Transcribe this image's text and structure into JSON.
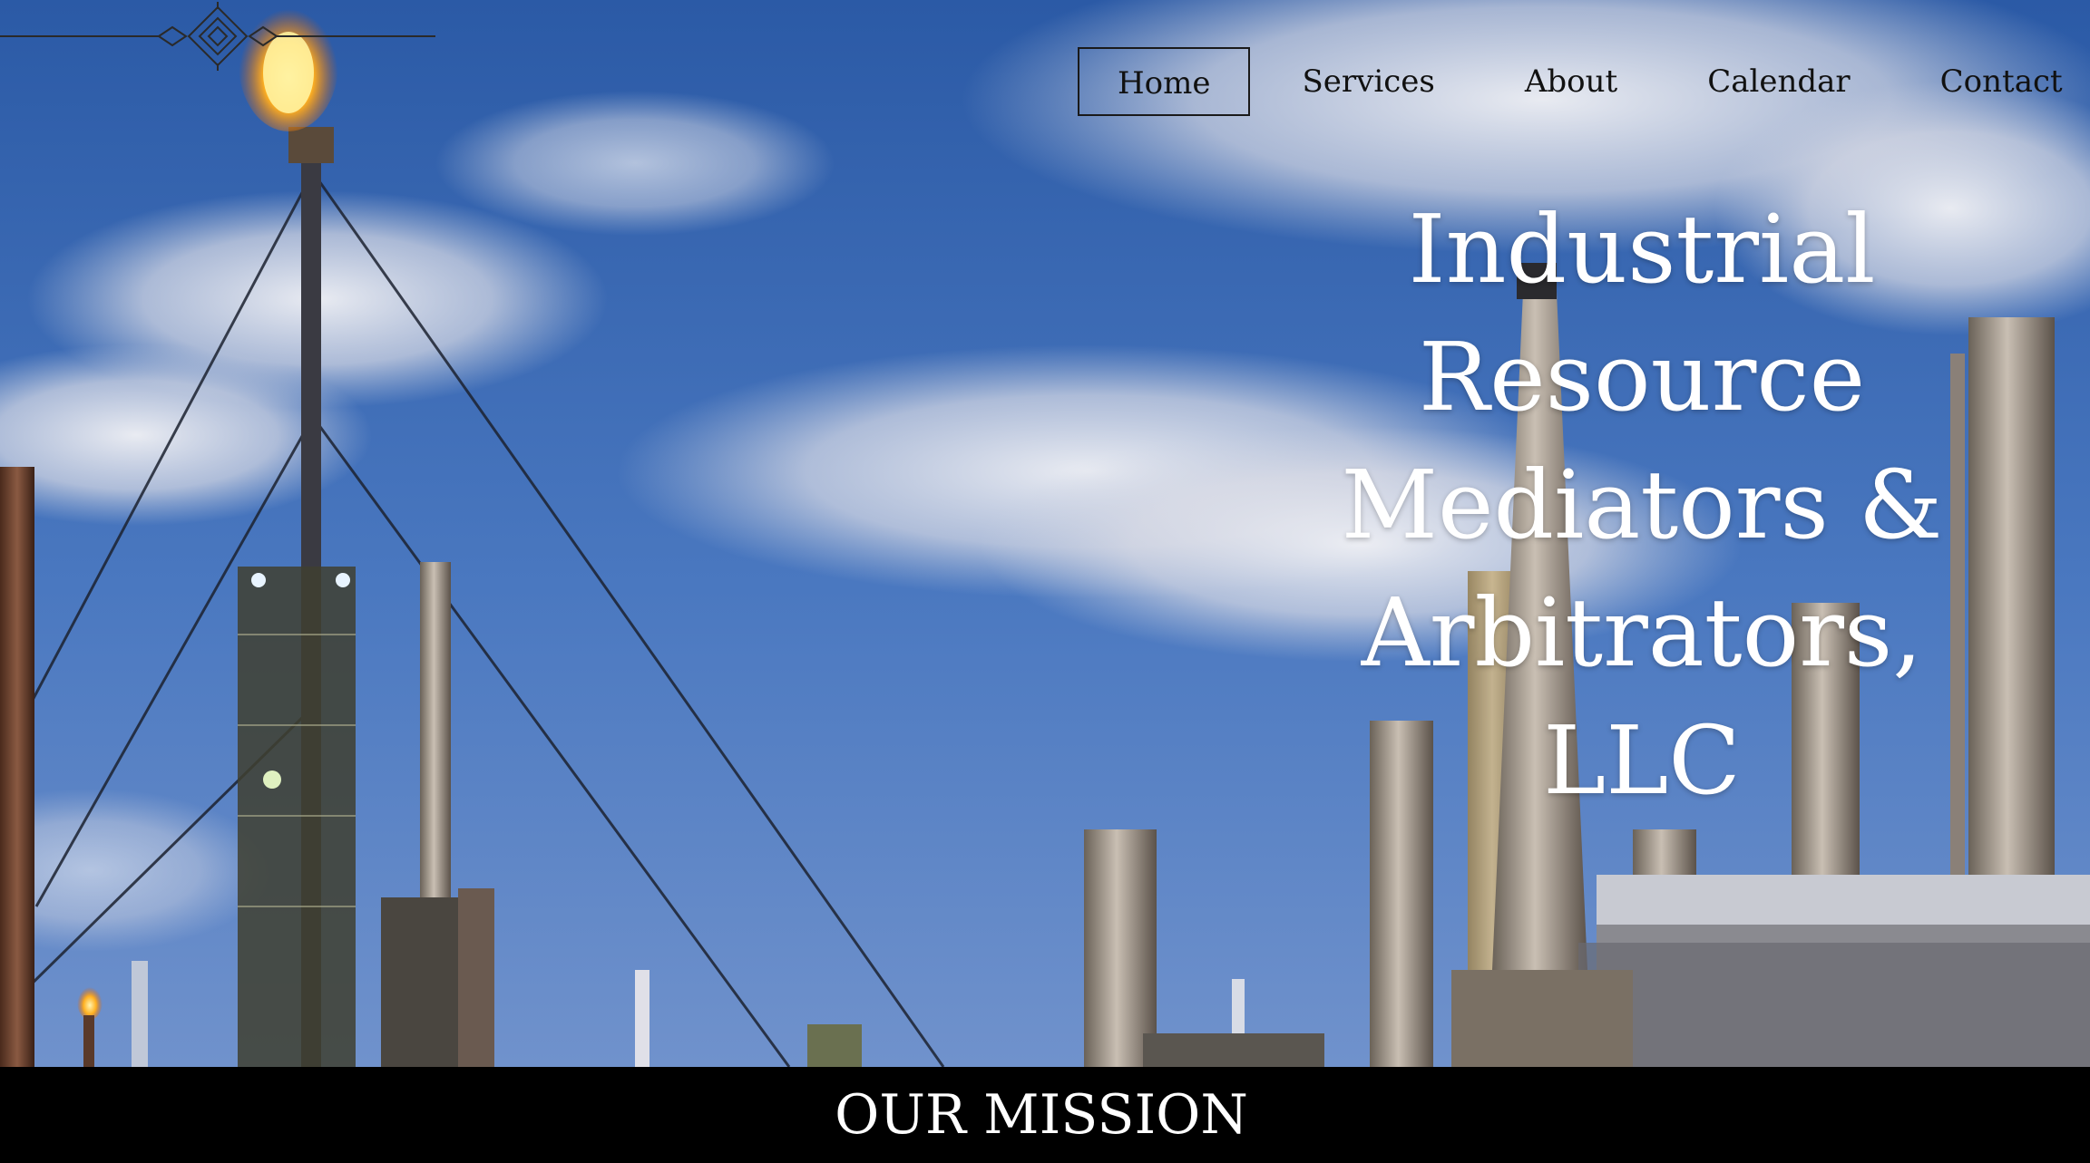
{
  "nav": {
    "items": [
      {
        "label": "Home",
        "active": true
      },
      {
        "label": "Services",
        "active": false
      },
      {
        "label": "About",
        "active": false
      },
      {
        "label": "Calendar",
        "active": false
      },
      {
        "label": "Contact",
        "active": false
      }
    ]
  },
  "hero": {
    "title_lines": [
      "Industrial",
      "Resource",
      "Mediators &",
      "Arbitrators, LLC"
    ],
    "background": "refinery-skyline-photo",
    "colors": {
      "sky_top": "#2f5ea8",
      "sky_bottom": "#5b84c4",
      "text": "#ffffff"
    }
  },
  "mission": {
    "heading": "OUR MISSION",
    "bar_color": "#000000"
  }
}
